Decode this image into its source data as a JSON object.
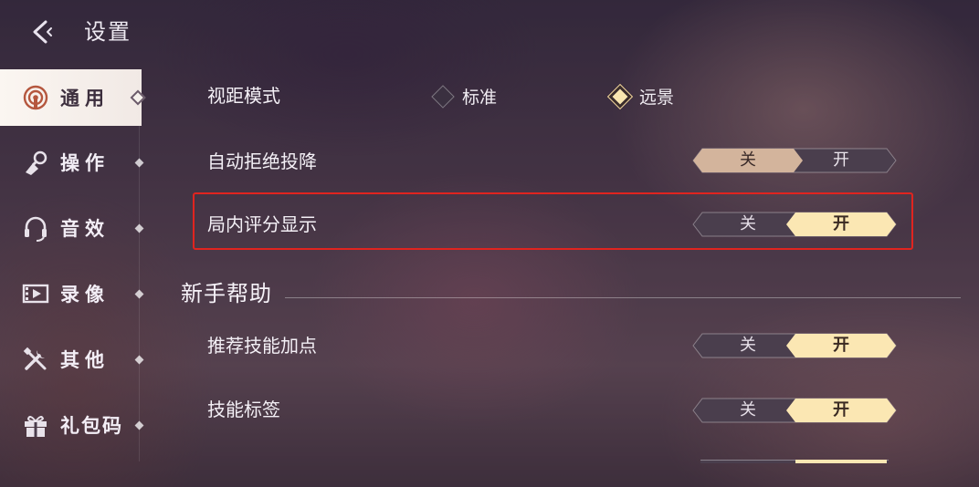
{
  "header": {
    "back_icon": "chevron-left-icon",
    "title": "设置"
  },
  "sidebar": {
    "items": [
      {
        "label": "通用",
        "icon": "signal-radar-icon",
        "active": true
      },
      {
        "label": "操作",
        "icon": "joystick-icon",
        "active": false
      },
      {
        "label": "音效",
        "icon": "headset-icon",
        "active": false
      },
      {
        "label": "录像",
        "icon": "film-icon",
        "active": false
      },
      {
        "label": "其他",
        "icon": "tools-icon",
        "active": false
      },
      {
        "label": "礼包码",
        "icon": "gift-icon",
        "active": false
      }
    ]
  },
  "settings": {
    "view_mode": {
      "label": "视距模式",
      "options": [
        {
          "label": "标准",
          "selected": false
        },
        {
          "label": "远景",
          "selected": true
        }
      ]
    },
    "auto_reject_surrender": {
      "label": "自动拒绝投降",
      "off": "关",
      "on": "开",
      "value": "off"
    },
    "in_game_score": {
      "label": "局内评分显示",
      "off": "关",
      "on": "开",
      "value": "on"
    }
  },
  "newbie_help": {
    "title": "新手帮助",
    "recommend_skill": {
      "label": "推荐技能加点",
      "off": "关",
      "on": "开",
      "value": "on"
    },
    "skill_tags": {
      "label": "技能标签",
      "off": "关",
      "on": "开",
      "value": "on"
    }
  },
  "colors": {
    "on_active": "#fbe7b3",
    "off_active": "#d3b49c",
    "inactive": "#4a3e4d",
    "highlight": "#e0241f"
  }
}
